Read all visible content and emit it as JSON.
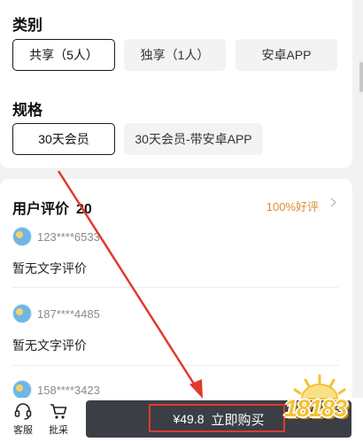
{
  "category": {
    "title": "类别",
    "options": [
      {
        "label": "共享（5人）",
        "selected": true
      },
      {
        "label": "独享（1人）",
        "selected": false
      },
      {
        "label": "安卓APP",
        "selected": false
      }
    ]
  },
  "spec": {
    "title": "规格",
    "options": [
      {
        "label": "30天会员",
        "selected": true
      },
      {
        "label": "30天会员-带安卓APP",
        "selected": false
      }
    ]
  },
  "reviews": {
    "title": "用户评价",
    "count": "20",
    "good_rate": "100%好评",
    "items": [
      {
        "user": "123****6533",
        "text": "暂无文字评价"
      },
      {
        "user": "187****4485",
        "text": "暂无文字评价"
      },
      {
        "user": "158****3423",
        "text": ""
      }
    ]
  },
  "bottom_bar": {
    "service_label": "客服",
    "purchase_label": "批采",
    "price": "¥49.8",
    "buy_label": "立即购买"
  },
  "watermark": {
    "text": "18183"
  },
  "colors": {
    "accent_orange": "#e08a33",
    "buy_button": "#3b3e45",
    "annotation_red": "#e03a2e"
  }
}
